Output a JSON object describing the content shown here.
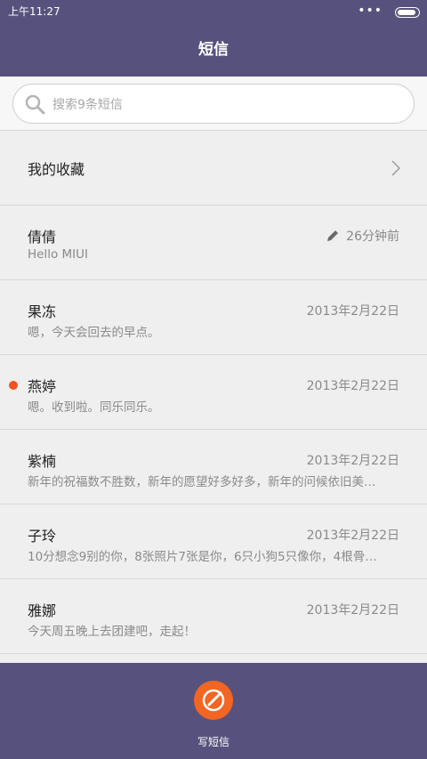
{
  "status_bar": {
    "time": "上午11:27",
    "signal_dots": "•••",
    "battery_level": 0.9
  },
  "header": {
    "title": "短信"
  },
  "search": {
    "placeholder": "搜索9条短信",
    "icon": "search-icon"
  },
  "favorites": {
    "label": "我的收藏"
  },
  "messages": [
    {
      "name": "倩倩",
      "preview": "Hello MIUI",
      "date": "26分钟前",
      "draft": true,
      "unread": false
    },
    {
      "name": "果冻",
      "preview": "嗯，今天会回去的早点。",
      "date": "2013年2月22日",
      "draft": false,
      "unread": false
    },
    {
      "name": "燕婷",
      "preview": "嗯。收到啦。同乐同乐。",
      "date": "2013年2月22日",
      "draft": false,
      "unread": true
    },
    {
      "name": "紫楠",
      "preview": "新年的祝福数不胜数，新年的愿望好多好多，新年的问候依旧美…",
      "date": "2013年2月22日",
      "draft": false,
      "unread": false
    },
    {
      "name": "子玲",
      "preview": "10分想念9别的你，8张照片7张是你，6只小狗5只像你，4根骨…",
      "date": "2013年2月22日",
      "draft": false,
      "unread": false
    },
    {
      "name": "雅娜",
      "preview": "今天周五晚上去团建吧，走起！",
      "date": "2013年2月22日",
      "draft": false,
      "unread": false
    }
  ],
  "bottom": {
    "compose_label": "写短信"
  },
  "colors": {
    "bar": "#57527d",
    "accent": "#f26522",
    "unread": "#f4521c"
  }
}
